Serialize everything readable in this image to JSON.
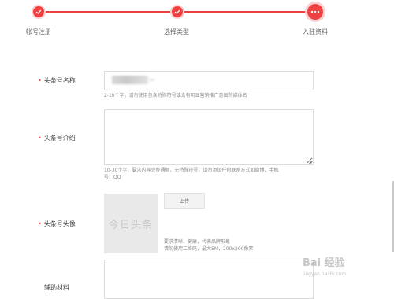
{
  "steps": [
    {
      "label": "帐号注册",
      "state": "done"
    },
    {
      "label": "选择类型",
      "state": "done"
    },
    {
      "label": "入驻资料",
      "state": "current"
    }
  ],
  "form": {
    "name": {
      "label": "头条号名称",
      "value": "",
      "hint": "2-10个字，请勿使用包含特殊符号或含有明显营销推广意图的媒体名"
    },
    "intro": {
      "label": "头条号介绍",
      "value": "",
      "hint_line1": "10-30个字，要求内容完整通顺，无特殊符号，请勿添加任何联系方式如微博、手机",
      "hint_line2": "号、QQ"
    },
    "avatar": {
      "label": "头条号头像",
      "placeholder": "今日头条",
      "upload_label": "上传",
      "hint_line1": "要求清晰、健康，代表品牌形象",
      "hint_line2": "请勿使用二维码，最大5M，200x200像素"
    },
    "material": {
      "label": "辅助材料"
    }
  },
  "watermark": {
    "logo": "Bai 经验",
    "url": "jingyan.baidu.com"
  },
  "colors": {
    "accent": "#f04142",
    "input_border": "#dcdcdc",
    "hint_text": "#8a8a8a",
    "avatar_bg": "#e9e9e9"
  },
  "icons": {
    "done": "check-circle-icon",
    "current": "more-dots-icon"
  }
}
